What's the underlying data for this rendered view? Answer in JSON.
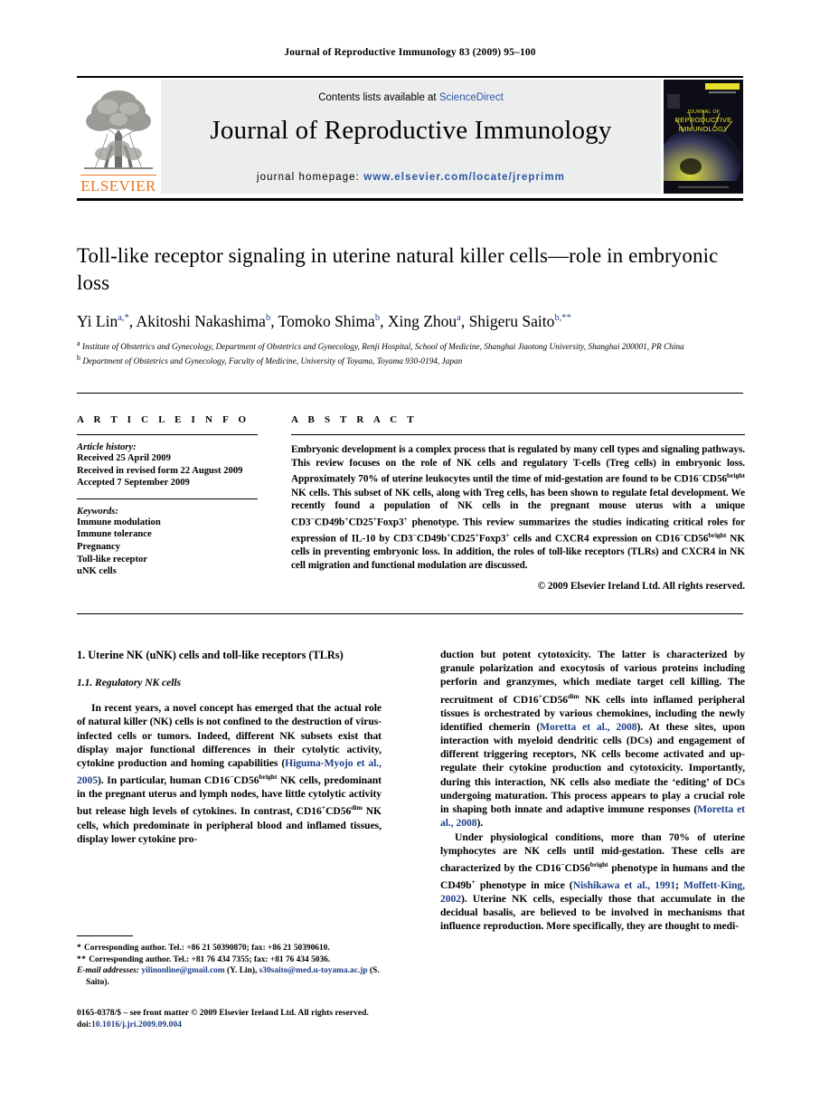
{
  "running_head": "Journal of Reproductive Immunology 83 (2009) 95–100",
  "masthead": {
    "contents_prefix": "Contents lists available at ",
    "sciencedirect": "ScienceDirect",
    "journal_title": "Journal of Reproductive Immunology",
    "homepage_prefix": "journal homepage: ",
    "homepage_url": "www.elsevier.com/locate/jreprimm",
    "publisher_wordmark": "ELSEVIER",
    "cover_line1": "JOURNAL OF",
    "cover_line2": "REPRODUCTIVE",
    "cover_line3": "IMMUNOLOGY"
  },
  "article": {
    "title": "Toll-like receptor signaling in uterine natural killer cells—role in embryonic loss",
    "authors_html": "Yi Lin<sup>a,*</sup>, Akitoshi Nakashima<sup>b</sup>, Tomoko Shima<sup>b</sup>, Xing Zhou<sup>a</sup>, Shigeru Saito<sup>b,**</sup>",
    "affiliation_a": "Institute of Obstetrics and Gynecology, Department of Obstetrics and Gynecology, Renji Hospital, School of Medicine, Shanghai Jiaotong University, Shanghai 200001, PR China",
    "affiliation_b": "Department of Obstetrics and Gynecology, Faculty of Medicine, University of Toyama, Toyama 930-0194, Japan"
  },
  "article_info": {
    "label": "A R T I C L E   I N F O",
    "history_label": "Article history:",
    "history": [
      "Received 25 April 2009",
      "Received in revised form 22 August 2009",
      "Accepted 7 September 2009"
    ],
    "keywords_label": "Keywords:",
    "keywords": [
      "Immune modulation",
      "Immune tolerance",
      "Pregnancy",
      "Toll-like receptor",
      "uNK cells"
    ]
  },
  "abstract": {
    "label": "A B S T R A C T",
    "body_html": "Embryonic development is a complex process that is regulated by many cell types and signaling pathways. This review focuses on the role of NK cells and regulatory T-cells (Treg cells) in embryonic loss. Approximately 70% of uterine leukocytes until the time of mid-gestation are found to be CD16<sup class=\"sm\">−</sup>CD56<sup class=\"sm\">bright</sup> NK cells. This subset of NK cells, along with Treg cells, has been shown to regulate fetal development. We recently found a population of NK cells in the pregnant mouse uterus with a unique CD3<sup class=\"sm\">−</sup>CD49b<sup class=\"sm\">+</sup>CD25<sup class=\"sm\">+</sup>Foxp3<sup class=\"sm\">+</sup> phenotype. This review summarizes the studies indicating critical roles for expression of IL-10 by CD3<sup class=\"sm\">−</sup>CD49b<sup class=\"sm\">+</sup>CD25<sup class=\"sm\">+</sup>Foxp3<sup class=\"sm\">+</sup> cells and CXCR4 expression on CD16<sup class=\"sm\">−</sup>CD56<sup class=\"sm\">bright</sup> NK cells in preventing embryonic loss. In addition, the roles of toll-like receptors (TLRs) and CXCR4 in NK cell migration and functional modulation are discussed.",
    "copyright": "© 2009 Elsevier Ireland Ltd. All rights reserved."
  },
  "body": {
    "section_heading": "1.  Uterine NK (uNK) cells and toll-like receptors (TLRs)",
    "subsection_heading": "1.1.  Regulatory NK cells",
    "left_paragraph_html": "In recent years, a novel concept has emerged that the actual role of natural killer (NK) cells is not confined to the destruction of virus-infected cells or tumors. Indeed, different NK subsets exist that display major functional differences in their cytolytic activity, cytokine production and homing capabilities (<a class=\"cit\" href=\"#\">Higuma-Myojo et al., 2005</a>). In particular, human CD16<sup class=\"sm\">−</sup>CD56<sup class=\"sm\">bright</sup> NK cells, predominant in the pregnant uterus and lymph nodes, have little cytolytic activity but release high levels of cytokines. In contrast, CD16<sup class=\"sm\">+</sup>CD56<sup class=\"sm\">dim</sup> NK cells, which predominate in peripheral blood and inflamed tissues, display lower cytokine pro-",
    "right_paragraph_1_html": "duction but potent cytotoxicity. The latter is characterized by granule polarization and exocytosis of various proteins including perforin and granzymes, which mediate target cell killing. The recruitment of CD16<sup class=\"sm\">+</sup>CD56<sup class=\"sm\">dim</sup> NK cells into inflamed peripheral tissues is orchestrated by various chemokines, including the newly identified chemerin (<a class=\"cit\" href=\"#\">Moretta et al., 2008</a>). At these sites, upon interaction with myeloid dendritic cells (DCs) and engagement of different triggering receptors, NK cells become activated and up-regulate their cytokine production and cytotoxicity. Importantly, during this interaction, NK cells also mediate the ‘editing’ of DCs undergoing maturation. This process appears to play a crucial role in shaping both innate and adaptive immune responses (<a class=\"cit\" href=\"#\">Moretta et al., 2008</a>).",
    "right_paragraph_2_html": "Under physiological conditions, more than 70% of uterine lymphocytes are NK cells until mid-gestation. These cells are characterized by the CD16<sup class=\"sm\">−</sup>CD56<sup class=\"sm\">bright</sup> phenotype in humans and the CD49b<sup class=\"sm\">+</sup> phenotype in mice (<a class=\"cit\" href=\"#\">Nishikawa et al., 1991</a>; <a class=\"cit\" href=\"#\">Moffett-King, 2002</a>). Uterine NK cells, especially those that accumulate in the decidual basalis, are believed to be involved in mechanisms that influence reproduction. More specifically, they are thought to medi-"
  },
  "footnotes": {
    "note_1": "Corresponding author. Tel.: +86 21 50390870; fax: +86 21 50390610.",
    "note_2": "Corresponding author. Tel.: +81 76 434 7355; fax: +81 76 434 5036.",
    "email_label": "E-mail addresses:",
    "email_1": "yilinonline@gmail.com",
    "email_1_owner": "(Y. Lin),",
    "email_2": "s30saito@med.u-toyama.ac.jp",
    "email_2_owner": "(S. Saito)."
  },
  "footer": {
    "issn_line": "0165-0378/$ – see front matter © 2009 Elsevier Ireland Ltd. All rights reserved.",
    "doi_label": "doi:",
    "doi_value": "10.1016/j.jri.2009.09.004"
  }
}
